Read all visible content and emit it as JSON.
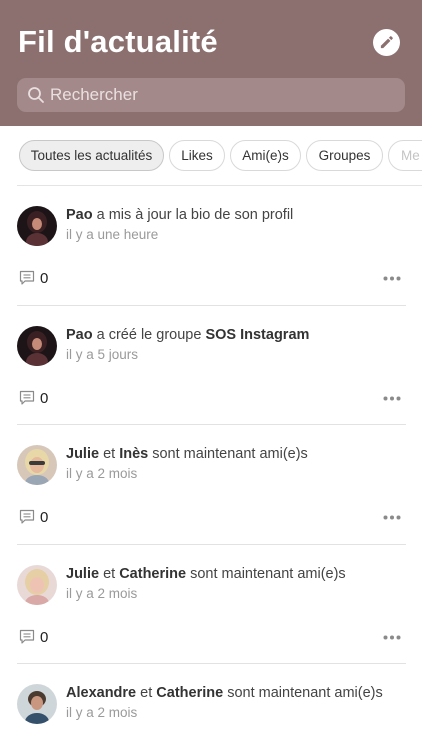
{
  "header": {
    "title": "Fil d'actualité",
    "search_placeholder": "Rechercher",
    "edit_icon": "pencil-icon",
    "search_icon": "search-icon",
    "background_color": "#8b706f"
  },
  "filters": {
    "items": [
      {
        "label": "Toutes les actualités",
        "active": true
      },
      {
        "label": "Likes",
        "active": false
      },
      {
        "label": "Ami(e)s",
        "active": false
      },
      {
        "label": "Groupes",
        "active": false
      },
      {
        "label": "Me",
        "active": false
      }
    ]
  },
  "posts": [
    {
      "parts": [
        {
          "text": "Pao",
          "bold": true
        },
        {
          "text": " a mis à jour la bio de son profil",
          "bold": false
        }
      ],
      "time": "il y a une heure",
      "comments": "0"
    },
    {
      "parts": [
        {
          "text": "Pao",
          "bold": true
        },
        {
          "text": " a créé le groupe ",
          "bold": false
        },
        {
          "text": "SOS Instagram",
          "bold": true
        }
      ],
      "time": "il y a 5 jours",
      "comments": "0"
    },
    {
      "parts": [
        {
          "text": "Julie",
          "bold": true
        },
        {
          "text": " et ",
          "bold": false
        },
        {
          "text": "Inès",
          "bold": true
        },
        {
          "text": " sont maintenant ami(e)s",
          "bold": false
        }
      ],
      "time": "il y a 2 mois",
      "comments": "0"
    },
    {
      "parts": [
        {
          "text": "Julie",
          "bold": true
        },
        {
          "text": " et ",
          "bold": false
        },
        {
          "text": "Catherine",
          "bold": true
        },
        {
          "text": " sont maintenant ami(e)s",
          "bold": false
        }
      ],
      "time": "il y a 2 mois",
      "comments": "0"
    },
    {
      "parts": [
        {
          "text": "Alexandre",
          "bold": true
        },
        {
          "text": " et ",
          "bold": false
        },
        {
          "text": "Catherine",
          "bold": true
        },
        {
          "text": " sont maintenant ami(e)s",
          "bold": false
        }
      ],
      "time": "il y a 2 mois",
      "comments": ""
    }
  ]
}
